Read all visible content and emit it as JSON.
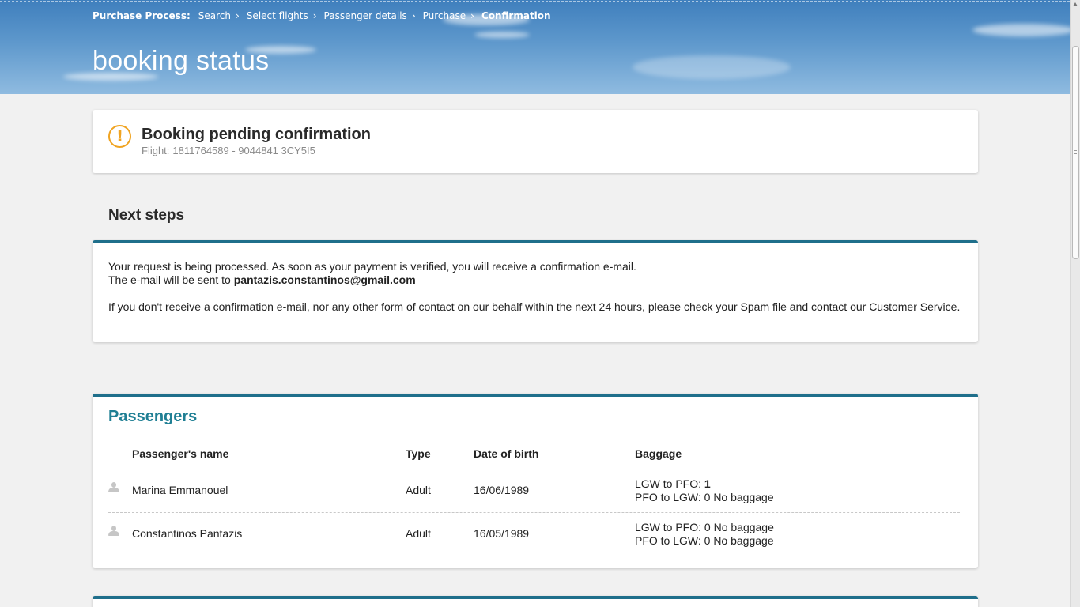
{
  "breadcrumb": {
    "lead": "Purchase Process:",
    "steps": [
      "Search",
      "Select flights",
      "Passenger details",
      "Purchase"
    ],
    "current": "Confirmation"
  },
  "hero": {
    "title": "booking status"
  },
  "status": {
    "title": "Booking pending confirmation",
    "flight_label": "Flight:",
    "flight_value": "1811764589 - 9044841 3CY5I5",
    "icon": "warning-circle-icon",
    "icon_color": "#f0a422"
  },
  "next_steps": {
    "title": "Next steps",
    "line1": "Your request is being processed. As soon as your payment is verified, you will receive a confirmation e-mail.",
    "line2_prefix": "The e-mail will be sent to",
    "email": "pantazis.constantinos@gmail.com",
    "line3": "If you don't receive a confirmation e-mail, nor any other form of contact on our behalf within the next 24 hours, please check your Spam file and contact our Customer Service."
  },
  "passengers": {
    "title": "Passengers",
    "headers": {
      "name": "Passenger's name",
      "type": "Type",
      "dob": "Date of birth",
      "baggage": "Baggage"
    },
    "rows": [
      {
        "name": "Marina Emmanouel",
        "type": "Adult",
        "dob": "16/06/1989",
        "bag1_prefix": "LGW to PFO:",
        "bag1_value": "1",
        "bag2": "PFO to LGW: 0 No baggage"
      },
      {
        "name": "Constantinos Pantazis",
        "type": "Adult",
        "dob": "16/05/1989",
        "bag1_prefix": "LGW to PFO: 0 No baggage",
        "bag1_value": "",
        "bag2": "PFO to LGW: 0 No baggage"
      }
    ]
  },
  "colors": {
    "accent": "#1f6f8b",
    "passenger_title": "#1f7f94",
    "warning": "#f0a422"
  }
}
